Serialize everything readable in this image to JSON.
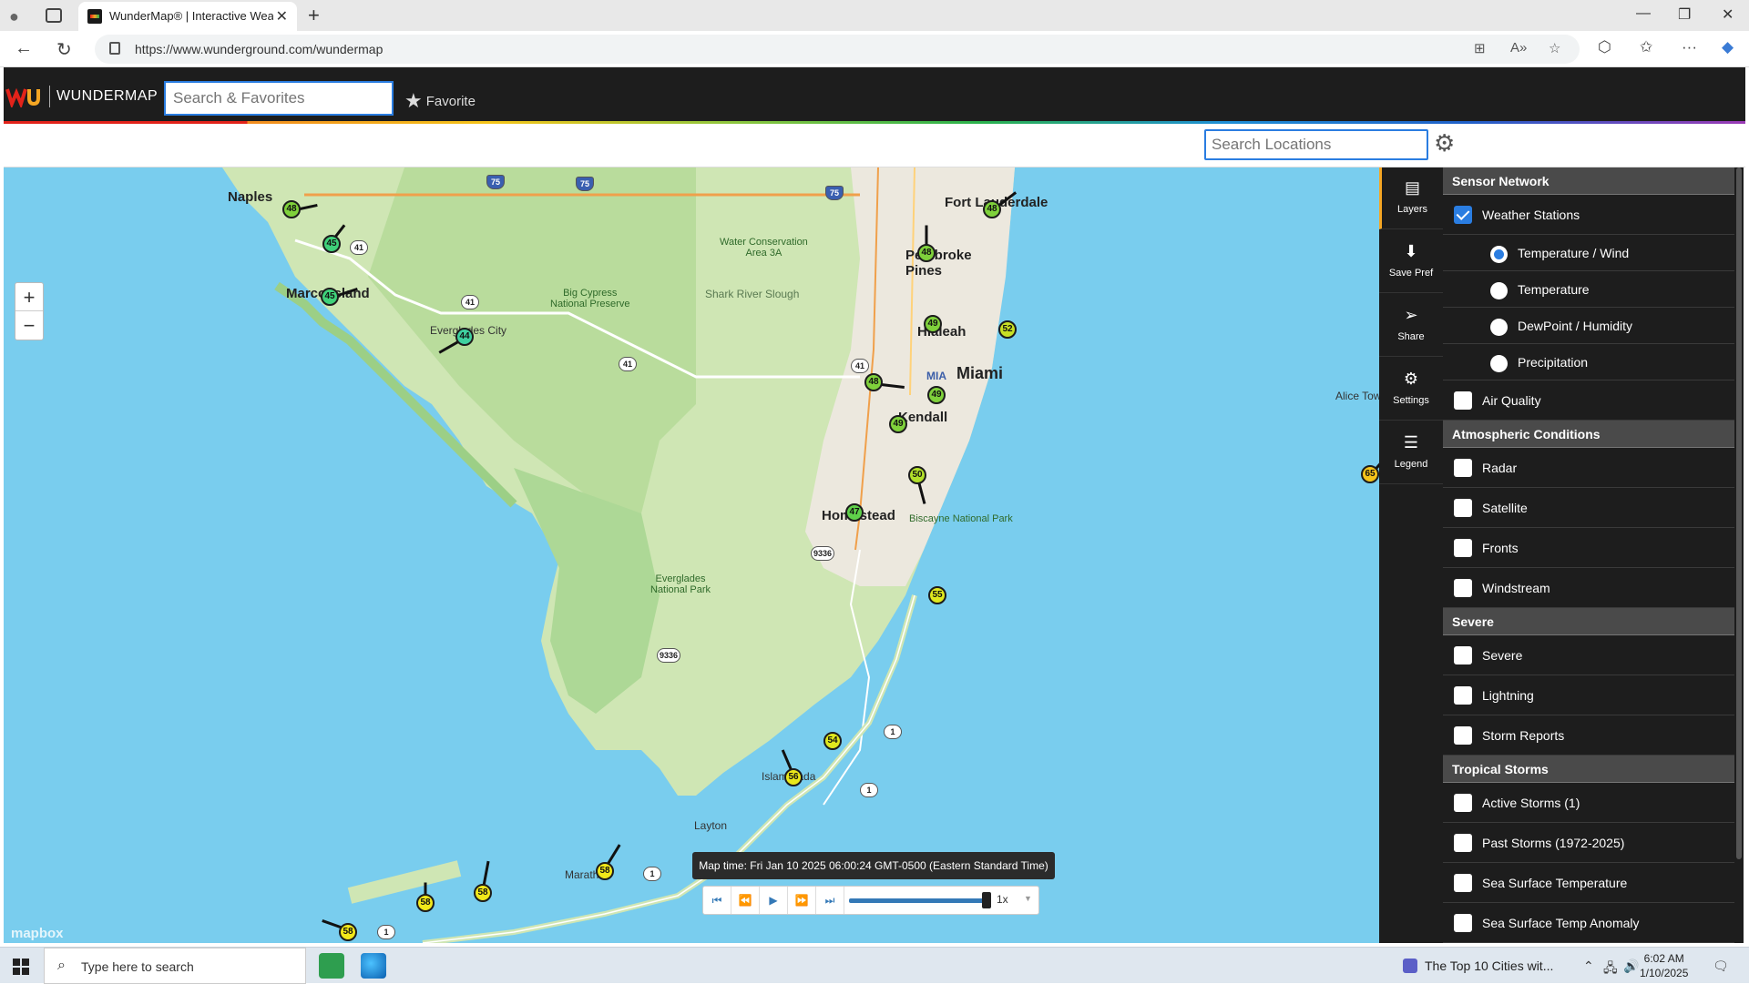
{
  "browser": {
    "tab_title": "WunderMap® | Interactive Weath",
    "url": "https://www.wunderground.com/wundermap"
  },
  "header": {
    "brand": "WUNDERMAP",
    "search_placeholder": "Search & Favorites",
    "favorite_label": "Favorite"
  },
  "subbar": {
    "location_placeholder": "Search Locations"
  },
  "map": {
    "places": {
      "naples": "Naples",
      "fort_lauderdale": "Fort Lauderdale",
      "pembroke_pines": "Pembroke\nPines",
      "hialeah": "Hialeah",
      "miami": "Miami",
      "mia": "MIA",
      "kendall": "Kendall",
      "homestead": "Homestead",
      "everglades_city": "Everglades City",
      "marco_island": "Marco Island",
      "islamorada": "Islamorada",
      "marathon": "Marathon",
      "layton": "Layton",
      "alice_town": "Alice Tow",
      "water_conservation": "Water Conservation\nArea 3A",
      "shark_river": "Shark River Slough",
      "big_cypress": "Big Cypress\nNational Preserve",
      "biscayne": "Biscayne National Park",
      "everglades_np": "Everglades\nNational Park"
    },
    "shields": [
      "75",
      "75",
      "75",
      "41",
      "41",
      "41",
      "41",
      "9336",
      "9336",
      "1",
      "1",
      "1",
      "1",
      "1",
      "1"
    ],
    "stations": [
      {
        "temp": "48",
        "color": "#7fd13b"
      },
      {
        "temp": "45",
        "color": "#3fd17a"
      },
      {
        "temp": "45",
        "color": "#3fd17a"
      },
      {
        "temp": "44",
        "color": "#3fd1a0"
      },
      {
        "temp": "48",
        "color": "#7fd13b"
      },
      {
        "temp": "48",
        "color": "#7fd13b"
      },
      {
        "temp": "49",
        "color": "#7fd13b"
      },
      {
        "temp": "52",
        "color": "#c8e024"
      },
      {
        "temp": "48",
        "color": "#7fd13b"
      },
      {
        "temp": "49",
        "color": "#7fd13b"
      },
      {
        "temp": "49",
        "color": "#7fd13b"
      },
      {
        "temp": "50",
        "color": "#b2e02a"
      },
      {
        "temp": "47",
        "color": "#5fd14a"
      },
      {
        "temp": "55",
        "color": "#e0e81e"
      },
      {
        "temp": "54",
        "color": "#e0e81e"
      },
      {
        "temp": "56",
        "color": "#eae81a"
      },
      {
        "temp": "58",
        "color": "#f2e81a"
      },
      {
        "temp": "58",
        "color": "#f2e81a"
      },
      {
        "temp": "58",
        "color": "#f2e81a"
      },
      {
        "temp": "58",
        "color": "#f2e81a"
      },
      {
        "temp": "65",
        "color": "#f5c41a"
      }
    ],
    "attribution": "mapbox",
    "map_time": "Map time: Fri Jan 10 2025 06:00:24 GMT-0500 (Eastern Standard Time)",
    "speed": "1x"
  },
  "tools": [
    {
      "label": "Layers",
      "icon": "layers-icon"
    },
    {
      "label": "Save Pref",
      "icon": "download-icon"
    },
    {
      "label": "Share",
      "icon": "share-icon"
    },
    {
      "label": "Settings",
      "icon": "gear-icon"
    },
    {
      "label": "Legend",
      "icon": "list-icon"
    }
  ],
  "panel": {
    "sensor_network": {
      "title": "Sensor Network",
      "weather_stations": "Weather Stations",
      "options": [
        "Temperature / Wind",
        "Temperature",
        "DewPoint / Humidity",
        "Precipitation"
      ],
      "air_quality": "Air Quality"
    },
    "atmospheric": {
      "title": "Atmospheric Conditions",
      "items": [
        "Radar",
        "Satellite",
        "Fronts",
        "Windstream"
      ]
    },
    "severe": {
      "title": "Severe",
      "items": [
        "Severe",
        "Lightning",
        "Storm Reports"
      ]
    },
    "tropical": {
      "title": "Tropical Storms",
      "items": [
        "Active Storms (1)",
        "Past Storms (1972-2025)",
        "Sea Surface Temperature",
        "Sea Surface Temp Anomaly"
      ]
    }
  },
  "taskbar": {
    "search_placeholder": "Type here to search",
    "news": "The Top 10 Cities wit...",
    "time": "6:02 AM",
    "date": "1/10/2025"
  }
}
